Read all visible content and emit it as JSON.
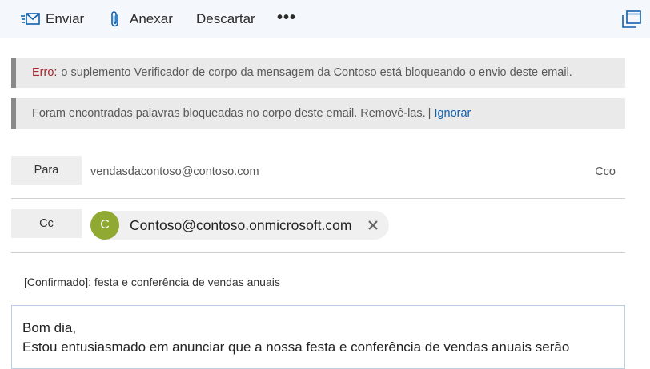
{
  "toolbar": {
    "send_label": "Enviar",
    "attach_label": "Anexar",
    "discard_label": "Descartar",
    "more_label": "•••"
  },
  "banners": {
    "error_prefix": "Erro:",
    "error_text": "o suplemento Verificador de corpo da mensagem da Contoso está bloqueando o envio deste email.",
    "warning_text": "Foram encontradas palavras bloqueadas no corpo deste email. Removê-las.",
    "separator": "|",
    "ignore_link": "Ignorar"
  },
  "to_field": {
    "label": "Para",
    "value": "vendasdacontoso@contoso.com",
    "bcc_label": "Cco"
  },
  "cc_field": {
    "label": "Cc",
    "recipient": {
      "initial": "C",
      "email": "Contoso@contoso.onmicrosoft.com",
      "avatar_color": "#8fa932"
    }
  },
  "subject": "[Confirmado]: festa e conferência de vendas anuais",
  "body": {
    "line1": "Bom dia,",
    "line2": "Estou entusiasmado em anunciar que a nossa festa e conferência de vendas anuais serão"
  },
  "colors": {
    "accent": "#0f5fae",
    "error": "#a4262c",
    "toolbar_bg": "#f4f7fb"
  },
  "icons": {
    "send": "send-icon",
    "attach": "paperclip-icon",
    "popout": "popout-icon",
    "remove": "close-icon"
  }
}
